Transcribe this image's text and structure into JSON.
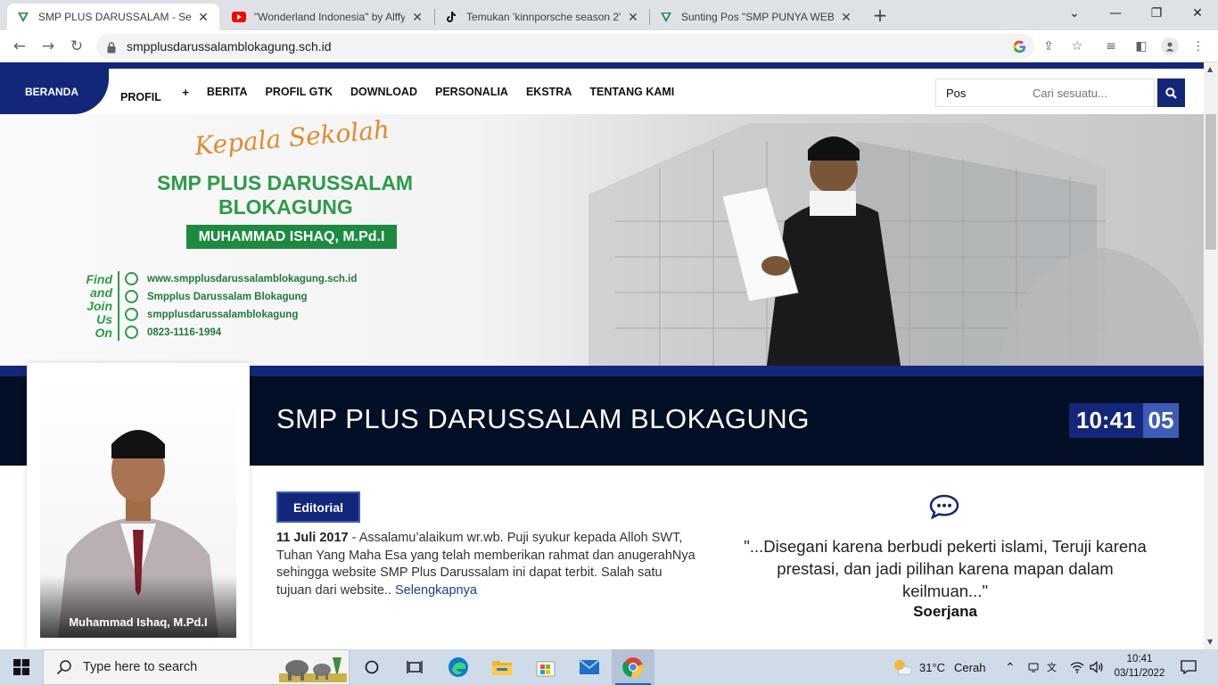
{
  "browser": {
    "tabs": [
      {
        "title": "SMP PLUS DARUSSALAM - Sekolah",
        "favicon": "site-logo-icon",
        "active": true
      },
      {
        "title": "\"Wonderland Indonesia\" by Alffy",
        "favicon": "youtube-icon",
        "active": false
      },
      {
        "title": "Temukan 'kinnporsche season 2'",
        "favicon": "tiktok-icon",
        "active": false
      },
      {
        "title": "Sunting Pos \"SMP PUNYA WEBSITE\"",
        "favicon": "site-logo-icon",
        "active": false
      }
    ],
    "url": "smpplusdarussalamblokagung.sch.id"
  },
  "nav": {
    "home": "BERANDA",
    "items": [
      "PROFIL",
      "BERITA",
      "PROFIL GTK",
      "DOWNLOAD",
      "PERSONALIA",
      "EKSTRA",
      "TENTANG KAMI"
    ],
    "profil_plus": "+",
    "search_scope": "Pos",
    "search_placeholder": "Cari sesuatu..."
  },
  "banner": {
    "kepsek_label": "Kepala Sekolah",
    "school_line1": "SMP PLUS DARUSSALAM",
    "school_line2": "BLOKAGUNG",
    "principal_name": "MUHAMMAD ISHAQ, M.Pd.I",
    "find_join_lines": [
      "Find",
      "and",
      "Join",
      "Us",
      "On"
    ],
    "contacts": [
      {
        "icon": "globe-icon",
        "text": "www.smpplusdarussalamblokagung.sch.id"
      },
      {
        "icon": "facebook-icon",
        "text": "Smpplus Darussalam Blokagung"
      },
      {
        "icon": "instagram-icon",
        "text": "smpplusdarussalamblokagung"
      },
      {
        "icon": "whatsapp-icon",
        "text": "0823-1116-1994"
      }
    ]
  },
  "header": {
    "site_title": "SMP PLUS DARUSSALAM BLOKAGUNG",
    "clock_hm": "10:41",
    "clock_s": "05"
  },
  "profile": {
    "caption": "Muhammad Ishaq, M.Pd.I"
  },
  "editorial": {
    "badge": "Editorial",
    "date": "11 Juli 2017",
    "text": " - Assalamu’alaikum wr.wb. Puji syukur kepada Alloh SWT, Tuhan Yang Maha Esa yang telah memberikan rahmat dan anugerahNya sehingga website SMP Plus Darussalam  ini dapat terbit. Salah satu tujuan dari website.. ",
    "more": "Selengkapnya"
  },
  "quote": {
    "text": "\"...Disegani karena berbudi pekerti islami, Teruji karena prestasi, dan jadi pilihan karena mapan dalam keilmuan...\"",
    "author": "Soerjana"
  },
  "taskbar": {
    "search_placeholder": "Type here to search",
    "weather_temp": "31°C",
    "weather_desc": "Cerah",
    "time": "10:41",
    "date": "03/11/2022"
  },
  "colors": {
    "brand_navy": "#13277a",
    "dark_band": "#020f24",
    "green": "#2d9c4a",
    "orange": "#e08c2c"
  }
}
